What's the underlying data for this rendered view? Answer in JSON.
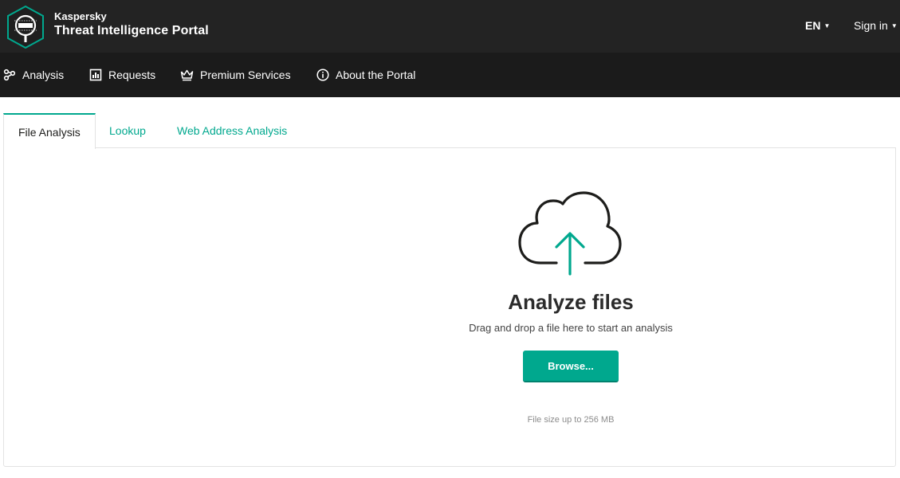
{
  "header": {
    "brand_small": "Kaspersky",
    "brand_title": "Threat Intelligence Portal",
    "logo_icon": "magnifier-shield-icon",
    "language": "EN",
    "sign_in": "Sign in"
  },
  "nav": {
    "items": [
      {
        "label": "Analysis",
        "icon": "analysis-graph-icon"
      },
      {
        "label": "Requests",
        "icon": "bar-chart-icon"
      },
      {
        "label": "Premium Services",
        "icon": "crown-icon"
      },
      {
        "label": "About the Portal",
        "icon": "info-icon"
      }
    ]
  },
  "tabs": [
    {
      "label": "File Analysis",
      "active": true
    },
    {
      "label": "Lookup",
      "active": false
    },
    {
      "label": "Web Address Analysis",
      "active": false
    }
  ],
  "upload": {
    "icon": "cloud-upload-icon",
    "title": "Analyze files",
    "subtitle": "Drag and drop a file here to start an analysis",
    "browse_label": "Browse...",
    "limit_text": "File size up to 256 MB"
  },
  "colors": {
    "accent": "#00a88e",
    "header_bg": "#232323",
    "nav_bg": "#1b1b1b"
  }
}
